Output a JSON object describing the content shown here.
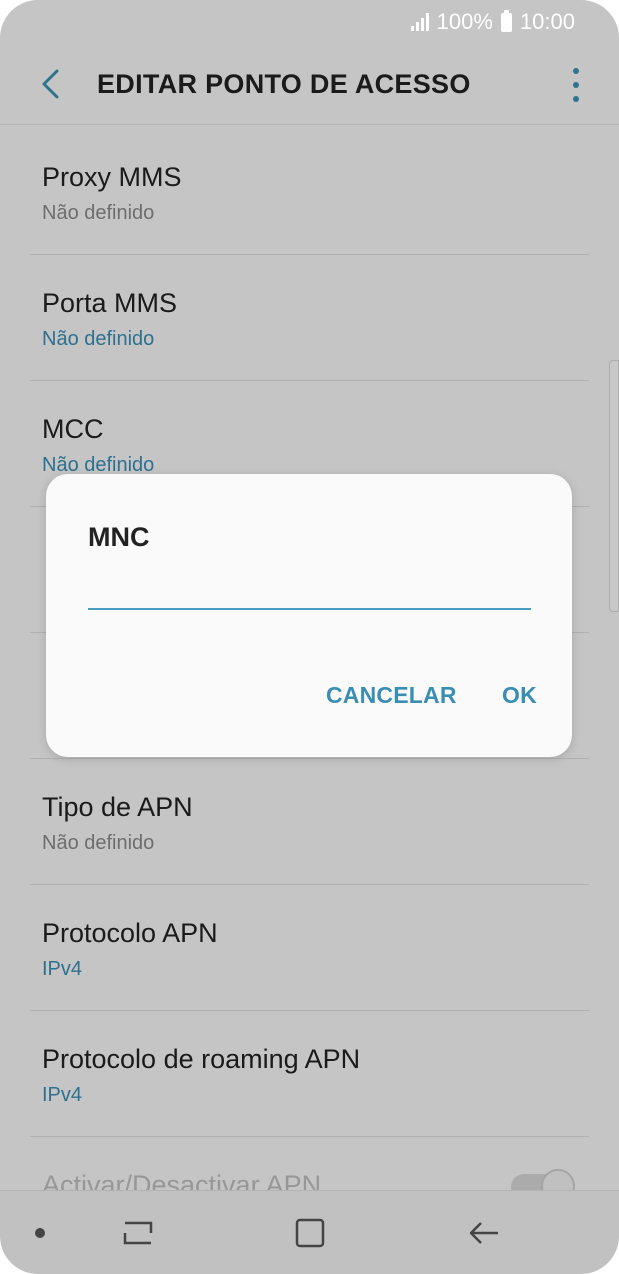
{
  "statusbar": {
    "battery_text": "100%",
    "time": "10:00"
  },
  "appbar": {
    "title": "EDITAR PONTO DE ACESSO"
  },
  "rows": [
    {
      "title": "Proxy MMS",
      "subtitle": "Não definido"
    },
    {
      "title": "Porta MMS",
      "subtitle": "Não definido"
    },
    {
      "title": "MCC",
      "subtitle": "Não definido"
    },
    {
      "title": "",
      "subtitle": ""
    },
    {
      "title": "",
      "subtitle": ""
    },
    {
      "title": "Tipo de APN",
      "subtitle": "Não definido"
    },
    {
      "title": "Protocolo APN",
      "subtitle": "IPv4"
    },
    {
      "title": "Protocolo de roaming APN",
      "subtitle": "IPv4"
    },
    {
      "title": "Activar/Desactivar APN",
      "subtitle": ""
    }
  ],
  "dialog": {
    "title": "MNC",
    "input_value": "",
    "cancel_label": "CANCELAR",
    "ok_label": "OK"
  },
  "colors": {
    "accent": "#3a8db3",
    "text": "#222222",
    "secondary": "#8a8a8a"
  }
}
